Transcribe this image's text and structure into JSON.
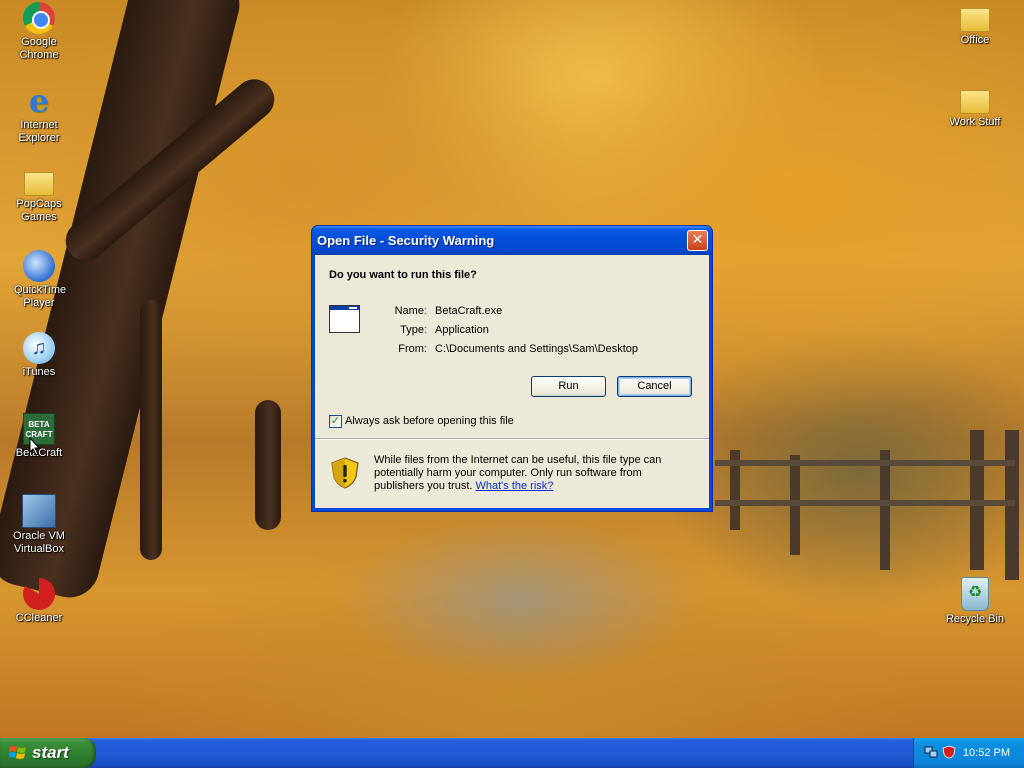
{
  "desktop": {
    "icons_left": [
      {
        "label": "Google Chrome",
        "icon": "chrome-icon"
      },
      {
        "label": "Internet Explorer",
        "icon": "internet-explorer-icon"
      },
      {
        "label": "PopCaps Games",
        "icon": "folder-icon"
      },
      {
        "label": "QuickTime Player",
        "icon": "quicktime-icon"
      },
      {
        "label": "iTunes",
        "icon": "itunes-icon"
      },
      {
        "label": "BetaCraft",
        "icon": "betacraft-icon"
      },
      {
        "label": "Oracle VM VirtualBox",
        "icon": "virtualbox-icon"
      },
      {
        "label": "CCleaner",
        "icon": "ccleaner-icon"
      }
    ],
    "icons_right": [
      {
        "label": "Office",
        "icon": "folder-icon"
      },
      {
        "label": "Work Stuff",
        "icon": "folder-icon"
      },
      {
        "label": "Recycle Bin",
        "icon": "recycle-bin-icon"
      }
    ],
    "betacraft_icon_text": "BETA CRAFT"
  },
  "dialog": {
    "title": "Open File - Security Warning",
    "close_glyph": "✕",
    "question": "Do you want to run this file?",
    "fields": [
      {
        "label": "Name:",
        "value": "BetaCraft.exe"
      },
      {
        "label": "Type:",
        "value": "Application"
      },
      {
        "label": "From:",
        "value": "C:\\Documents and Settings\\Sam\\Desktop"
      }
    ],
    "run_label": "Run",
    "cancel_label": "Cancel",
    "checkbox_label": "Always ask before opening this file",
    "checkbox_checked": true,
    "info_text": "While files from the Internet can be useful, this file type can potentially harm your computer. Only run software from publishers you trust.",
    "risk_link": "What's the risk?"
  },
  "taskbar": {
    "start_label": "start",
    "clock": "10:52 PM"
  },
  "colors": {
    "title_blue": "#0a46d8",
    "start_green": "#2e7d2e",
    "tray_blue": "#0c85da",
    "dialog_face": "#ece9d8"
  }
}
